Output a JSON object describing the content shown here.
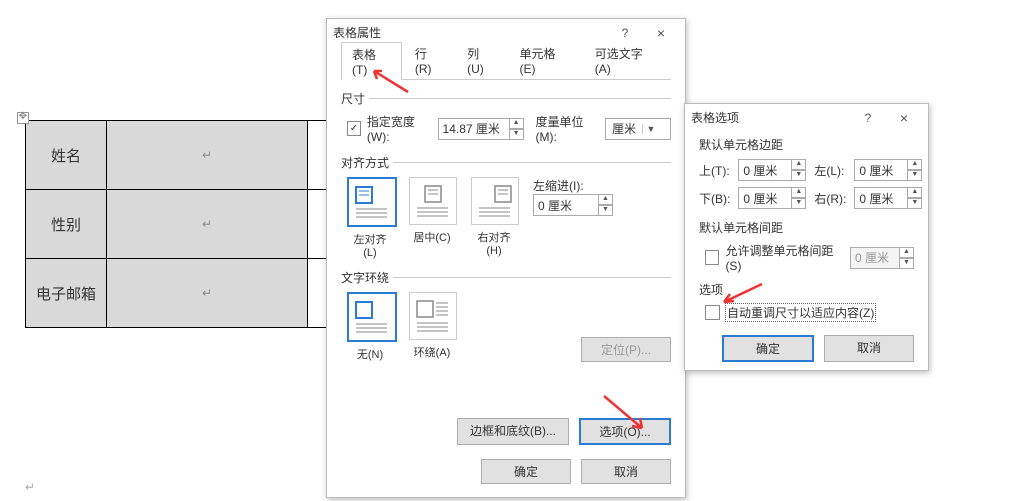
{
  "table": {
    "rows": [
      {
        "label": "姓名",
        "value": "↵"
      },
      {
        "label": "性别",
        "value": "↵"
      },
      {
        "label": "电子邮箱",
        "value": "↵"
      }
    ],
    "return_mark": "↵"
  },
  "dialog1": {
    "title": "表格属性",
    "help": "?",
    "close": "×",
    "tabs": [
      "表格(T)",
      "行(R)",
      "列(U)",
      "单元格(E)",
      "可选文字(A)"
    ],
    "size_legend": "尺寸",
    "specify_width_chk": true,
    "specify_width_label": "指定宽度(W):",
    "specify_width_value": "14.87 厘米",
    "unit_label": "度量单位(M):",
    "unit_value": "厘米",
    "align_legend": "对齐方式",
    "align_opts": [
      "左对齐(L)",
      "居中(C)",
      "右对齐(H)"
    ],
    "indent_label": "左缩进(I):",
    "indent_value": "0 厘米",
    "wrap_legend": "文字环绕",
    "wrap_opts": [
      "无(N)",
      "环绕(A)"
    ],
    "locate_btn": "定位(P)...",
    "border_btn": "边框和底纹(B)...",
    "options_btn": "选项(O)...",
    "ok": "确定",
    "cancel": "取消"
  },
  "dialog2": {
    "title": "表格选项",
    "help": "?",
    "close": "×",
    "margins_legend": "默认单元格边距",
    "top_l": "上(T):",
    "top_v": "0 厘米",
    "left_l": "左(L):",
    "left_v": "0 厘米",
    "bottom_l": "下(B):",
    "bottom_v": "0 厘米",
    "right_l": "右(R):",
    "right_v": "0 厘米",
    "spacing_legend": "默认单元格间距",
    "allow_spacing_chk": false,
    "allow_spacing_label": "允许调整单元格间距(S)",
    "allow_spacing_value": "0 厘米",
    "options_legend": "选项",
    "autofit_chk": false,
    "autofit_label": "自动重调尺寸以适应内容(Z)",
    "ok": "确定",
    "cancel": "取消"
  }
}
